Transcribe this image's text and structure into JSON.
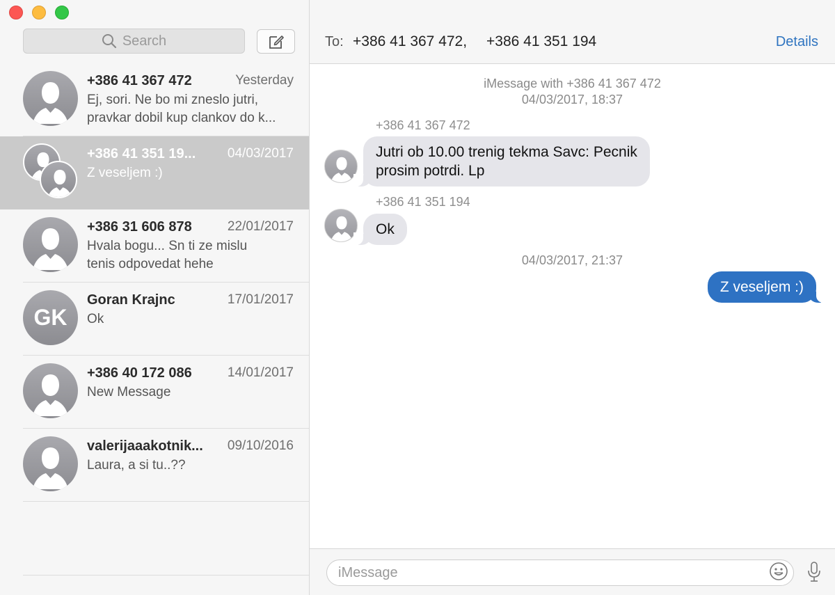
{
  "search": {
    "placeholder": "Search"
  },
  "conversations": [
    {
      "name": "+386 41 367 472",
      "date": "Yesterday",
      "preview": [
        "Ej, sori. Ne bo mi zneslo jutri,",
        "pravkar dobil kup clankov do k..."
      ],
      "selected": false
    },
    {
      "name": "+386 41 351 19...",
      "date": "04/03/2017",
      "preview": [
        "Z veseljem :)"
      ],
      "selected": true
    },
    {
      "name": "+386 31 606 878",
      "date": "22/01/2017",
      "preview": [
        "Hvala bogu... Sn ti ze mislu",
        "tenis odpovedat hehe"
      ],
      "selected": false
    },
    {
      "name": "Goran Krajnc",
      "initials": "GK",
      "date": "17/01/2017",
      "preview": [
        "Ok"
      ],
      "selected": false
    },
    {
      "name": "+386 40 172 086",
      "date": "14/01/2017",
      "preview": [
        "New Message"
      ],
      "selected": false
    },
    {
      "name": "valerijaaakotnik...",
      "date": "09/10/2016",
      "preview": [
        "Laura, a si tu..??"
      ],
      "selected": false
    }
  ],
  "header": {
    "to_label": "To:",
    "recipients": [
      "+386 41 367 472,",
      "+386 41 351 194"
    ],
    "details_label": "Details"
  },
  "thread": {
    "intro_line1": "iMessage with +386 41 367 472",
    "intro_line2": "04/03/2017, 18:37",
    "messages": [
      {
        "sender": "+386 41 367 472",
        "text": [
          "Jutri ob 10.00 trenig tekma Savc: Pecnik",
          "prosim potrdi. Lp"
        ],
        "direction": "in"
      },
      {
        "sender": "+386 41 351 194",
        "text": [
          "Ok"
        ],
        "direction": "in"
      },
      {
        "timestamp": "04/03/2017, 21:37"
      },
      {
        "text": [
          "Z veseljem :)"
        ],
        "direction": "out"
      }
    ]
  },
  "composer": {
    "placeholder": "iMessage"
  },
  "colors": {
    "accent": "#2f74c0",
    "outgoing_bubble": "#2e72c3",
    "incoming_bubble": "#e5e5ea",
    "selected_row": "#cacaca"
  },
  "icons": {
    "search": "search-icon",
    "compose": "compose-icon",
    "emoji": "emoji-icon",
    "mic": "microphone-icon",
    "avatar": "person-silhouette-icon"
  }
}
